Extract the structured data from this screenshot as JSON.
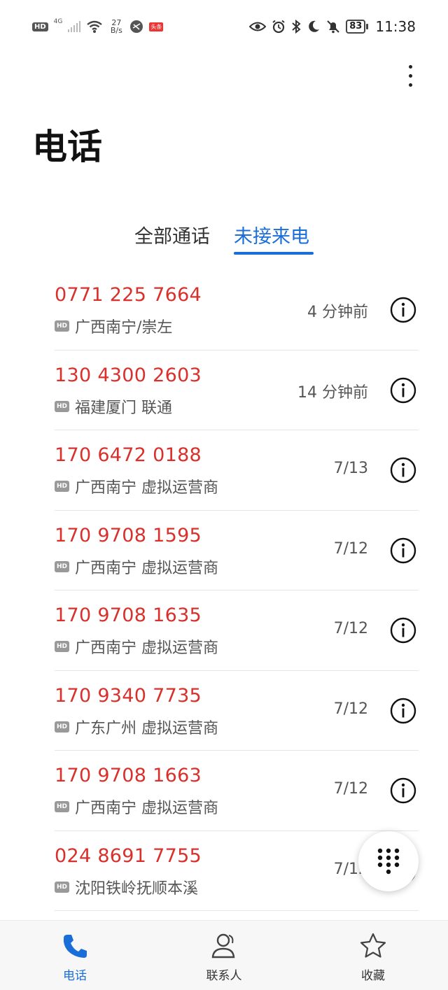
{
  "status_bar": {
    "hd": "HD",
    "network": "4G",
    "speed_value": "27",
    "speed_unit": "B/s",
    "app_badge": "头条",
    "battery": "83",
    "time": "11:38"
  },
  "header": {
    "title": "电话"
  },
  "tabs": [
    {
      "label": "全部通话",
      "active": false
    },
    {
      "label": "未接来电",
      "active": true
    }
  ],
  "calls": [
    {
      "number": "0771 225 7664",
      "badge": "HD",
      "location": "广西南宁/崇左",
      "time": "4 分钟前"
    },
    {
      "number": "130 4300 2603",
      "badge": "HD",
      "location": "福建厦门 联通",
      "time": "14 分钟前"
    },
    {
      "number": "170 6472 0188",
      "badge": "HD",
      "location": "广西南宁 虚拟运营商",
      "time": "7/13"
    },
    {
      "number": "170 9708 1595",
      "badge": "HD",
      "location": "广西南宁 虚拟运营商",
      "time": "7/12"
    },
    {
      "number": "170 9708 1635",
      "badge": "HD",
      "location": "广西南宁 虚拟运营商",
      "time": "7/12"
    },
    {
      "number": "170 9340 7735",
      "badge": "HD",
      "location": "广东广州 虚拟运营商",
      "time": "7/12"
    },
    {
      "number": "170 9708 1663",
      "badge": "HD",
      "location": "广西南宁 虚拟运营商",
      "time": "7/12"
    },
    {
      "number": "024 8691 7755",
      "badge": "HD",
      "location": "沈阳铁岭抚顺本溪",
      "time": "7/12"
    }
  ],
  "bottom_nav": {
    "phone": "电话",
    "contacts": "联系人",
    "favorites": "收藏"
  },
  "colors": {
    "accent": "#1a6ed8",
    "missed_call": "#d9302c"
  }
}
